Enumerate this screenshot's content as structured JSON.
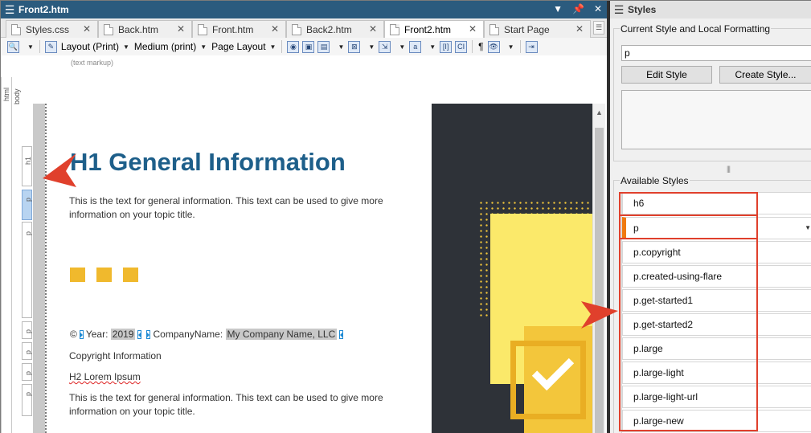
{
  "editor": {
    "title": "Front2.htm",
    "title_controls": [
      "▼",
      "📌",
      "✕"
    ],
    "tabs": [
      {
        "label": "Styles.css",
        "active": false
      },
      {
        "label": "Back.htm",
        "active": false
      },
      {
        "label": "Front.htm",
        "active": false
      },
      {
        "label": "Back2.htm",
        "active": false
      },
      {
        "label": "Front2.htm",
        "active": true
      },
      {
        "label": "Start Page",
        "active": false
      }
    ],
    "toolbar": {
      "layout": "Layout (Print)",
      "medium": "Medium (print)",
      "page_layout": "Page Layout",
      "markup_label": "(text markup)"
    },
    "structure_bar": {
      "html": "html",
      "body": "body",
      "h1": "h1",
      "p": "p"
    },
    "document": {
      "h1": "H1 General Information",
      "para1": "This is the text for general information. This text can be used to give more information on your topic title.",
      "copyright_symbol": "©",
      "year_label": "Year:",
      "year_value": "2019",
      "company_label": "CompanyName:",
      "company_value": "My Company Name, LLC",
      "copyright_info": "Copyright Information",
      "h2": "H2 Lorem Ipsum",
      "para2": "This is the text for general information. This text can be used to give more information on your topic title."
    }
  },
  "styles_pane": {
    "title": "Styles",
    "current_group": "Current Style and Local Formatting",
    "current_style": "p",
    "edit_style": "Edit Style",
    "create_style": "Create Style...",
    "available_group": "Available Styles",
    "available": [
      "h6",
      "p",
      "p.copyright",
      "p.created-using-flare",
      "p.get-started1",
      "p.get-started2",
      "p.large",
      "p.large-light",
      "p.large-light-url",
      "p.large-new"
    ],
    "selected_index": 1
  },
  "colors": {
    "title_bar": "#2b5b7e",
    "heading": "#1e5f8a",
    "accent_yellow": "#f0b92d",
    "callout_red": "#e0402c",
    "selected_orange": "#f07a10"
  }
}
